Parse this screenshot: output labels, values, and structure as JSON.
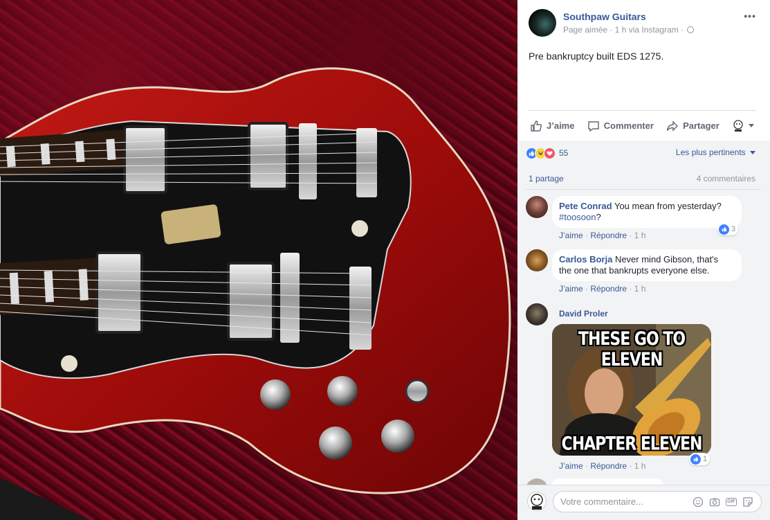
{
  "post": {
    "page_name": "Southpaw Guitars",
    "meta": "Page aimée · 1 h via Instagram ·",
    "text": "Pre bankruptcy built EDS 1275.",
    "more_icon": "more-icon"
  },
  "actions": {
    "like": "J’aime",
    "comment": "Commenter",
    "share": "Partager"
  },
  "reactions": {
    "count": "55",
    "sort": "Les plus pertinents",
    "shares": "1 partage",
    "comments": "4 commentaires"
  },
  "comments": [
    {
      "author": "Pete Conrad",
      "text": "You mean from yesterday?",
      "hashtag": "#toosoon",
      "after": "?",
      "like": "J’aime",
      "reply": "Répondre",
      "time": "1 h",
      "reactions": "3"
    },
    {
      "author": "Carlos Borja",
      "text_line1": "Never mind Gibson, that's",
      "text_line2": "the one that bankrupts everyone else.",
      "like": "J’aime",
      "reply": "Répondre",
      "time": "1 h"
    },
    {
      "author": "David Proler",
      "meme_top": "THESE GO TO ELEVEN",
      "meme_bottom": "CHAPTER ELEVEN",
      "like": "J’aime",
      "reply": "Répondre",
      "time": "1 h",
      "reactions": "1"
    }
  ],
  "compose": {
    "placeholder": "Votre commentaire..."
  },
  "colors": {
    "link": "#385898",
    "muted": "#90949c",
    "like_blue": "#4080ff",
    "love_red": "#f25268"
  }
}
